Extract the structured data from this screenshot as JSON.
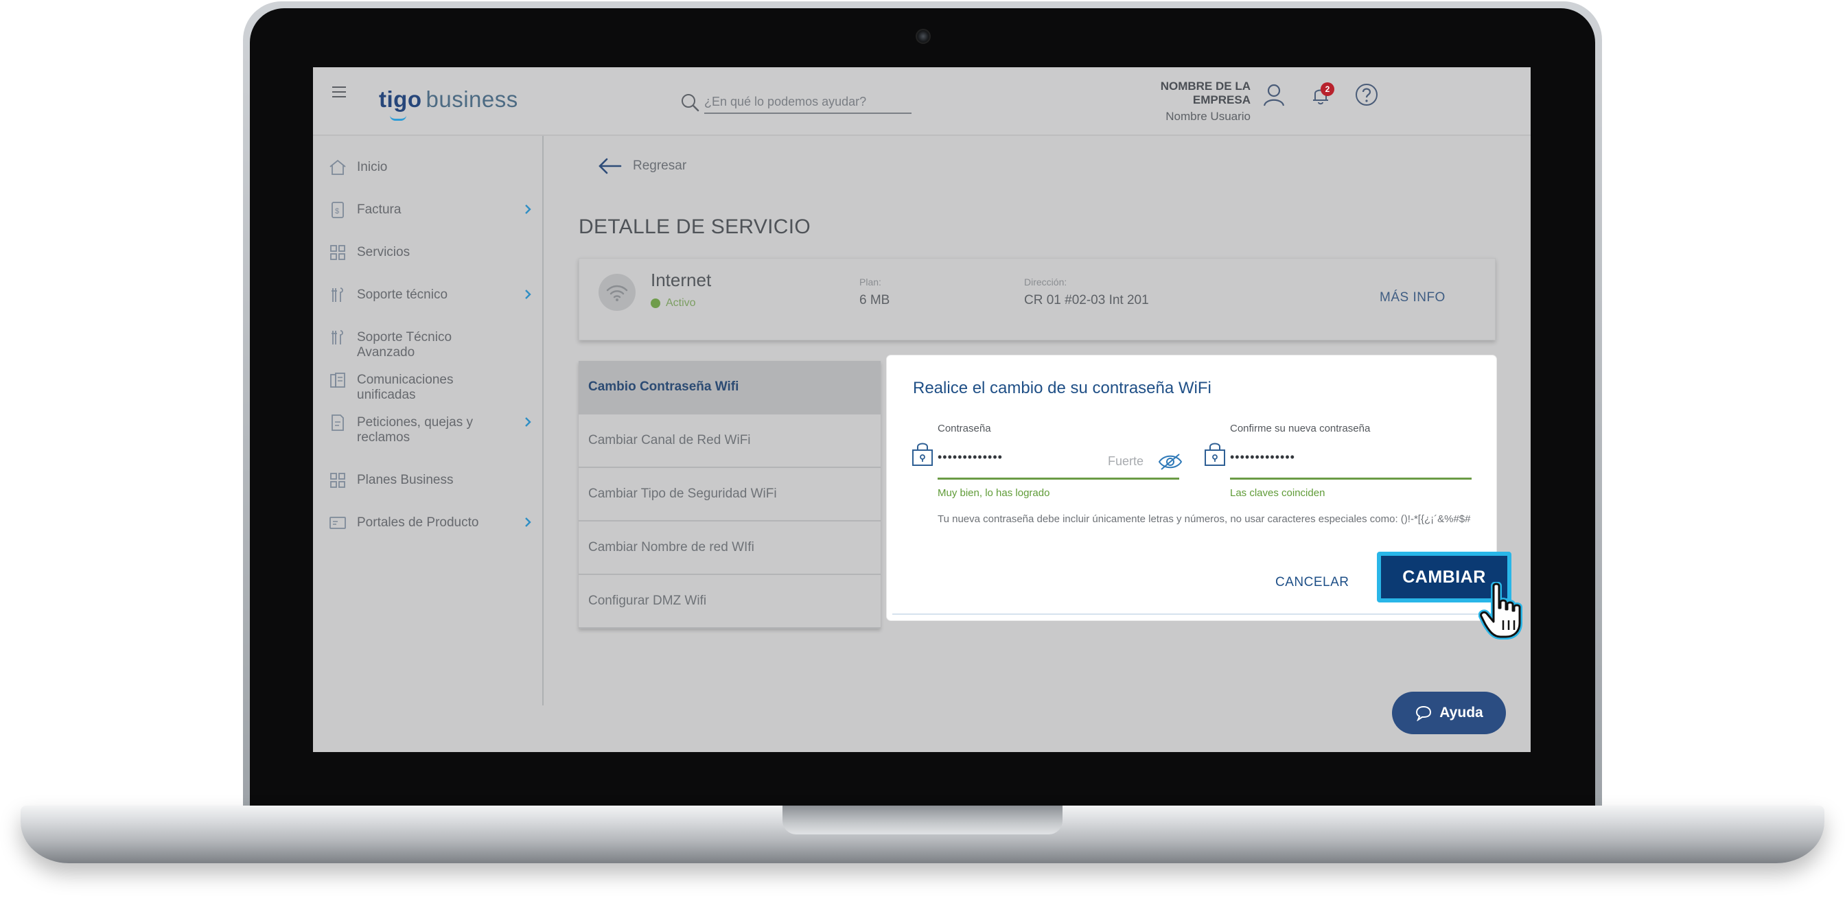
{
  "header": {
    "logo_tigo": "tigo",
    "logo_business": "business",
    "search_placeholder": "¿En qué lo podemos ayudar?",
    "company_name": "NOMBRE DE LA EMPRESA",
    "user_name": "Nombre Usuario",
    "notification_count": "2"
  },
  "sidebar": {
    "items": [
      {
        "label": "Inicio",
        "icon": "home-icon",
        "has_submenu": false
      },
      {
        "label": "Factura",
        "icon": "invoice-icon",
        "has_submenu": true
      },
      {
        "label": "Servicios",
        "icon": "grid-icon",
        "has_submenu": false
      },
      {
        "label": "Soporte técnico",
        "icon": "tools-icon",
        "has_submenu": true
      },
      {
        "label": "Soporte Técnico Avanzado",
        "icon": "tools-icon",
        "has_submenu": false
      },
      {
        "label": "Comunicaciones unificadas",
        "icon": "building-icon",
        "has_submenu": false
      },
      {
        "label": "Peticiones, quejas y reclamos",
        "icon": "document-edit-icon",
        "has_submenu": true
      },
      {
        "label": "Planes Business",
        "icon": "grid-icon",
        "has_submenu": false
      },
      {
        "label": "Portales de Producto",
        "icon": "portal-icon",
        "has_submenu": true
      }
    ]
  },
  "main": {
    "back_label": "Regresar",
    "page_title": "DETALLE DE SERVICIO",
    "service": {
      "name": "Internet",
      "status": "Activo",
      "plan_label": "Plan:",
      "plan_value": "6 MB",
      "address_label": "Dirección:",
      "address_value": "CR 01 #02-03 Int 201",
      "more_info": "MÁS INFO"
    },
    "options": [
      {
        "label": "Cambio Contraseña Wifi",
        "active": true
      },
      {
        "label": "Cambiar Canal de Red WiFi",
        "active": false
      },
      {
        "label": "Cambiar Tipo de Seguridad WiFi",
        "active": false
      },
      {
        "label": "Cambiar Nombre de red WIfi",
        "active": false
      },
      {
        "label": "Configurar DMZ Wifi",
        "active": false
      }
    ]
  },
  "modal": {
    "title": "Realice el cambio de su contraseña WiFi",
    "password_label": "Contraseña",
    "password_value": "•••••••••••••",
    "password_strength": "Fuerte",
    "password_hint": "Muy bien, lo has logrado",
    "confirm_label": "Confirme su nueva contraseña",
    "confirm_value": "•••••••••••••",
    "confirm_hint": "Las claves coinciden",
    "rules_text": "Tu nueva contraseña debe incluir únicamente letras y números, no usar caracteres especiales como: ()!-*[{¿¡´&%#$#",
    "cancel_label": "CANCELAR",
    "submit_label": "CAMBIAR"
  },
  "help_button": "Ayuda",
  "colors": {
    "brand_navy": "#0b3a73",
    "highlight_cyan": "#29b6e8",
    "success_green": "#5f9b37",
    "overlay_gray": "#c9c9ca"
  }
}
